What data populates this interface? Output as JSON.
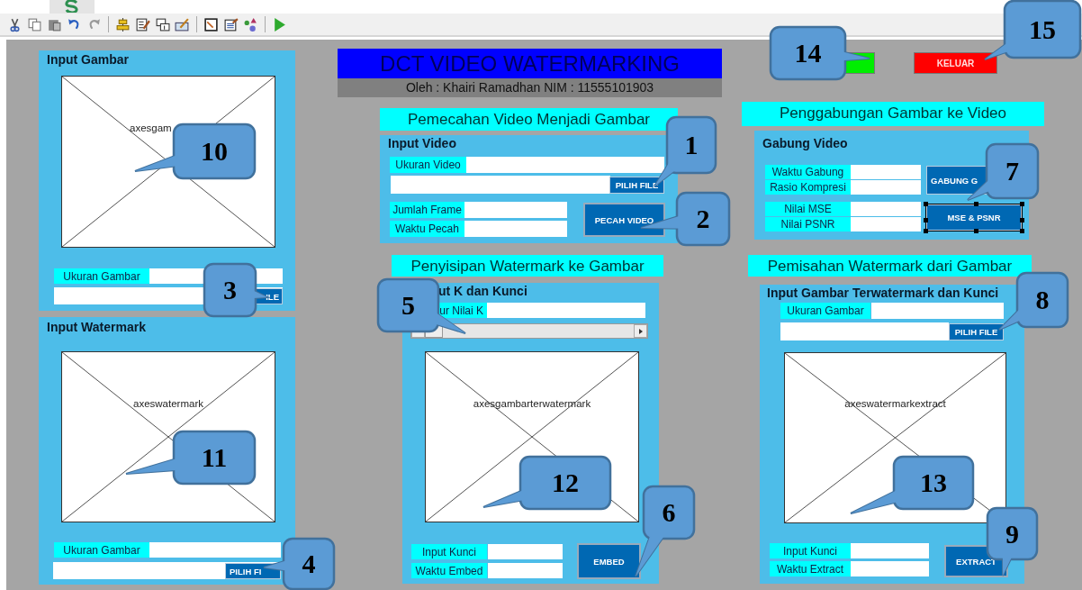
{
  "toolbar": {
    "groups": [
      [
        {
          "kind": "cut"
        },
        {
          "kind": "copy"
        },
        {
          "kind": "paste"
        },
        {
          "kind": "undo"
        },
        {
          "kind": "redo"
        }
      ],
      [
        {
          "kind": "align"
        },
        {
          "kind": "docpen"
        },
        {
          "kind": "tab"
        },
        {
          "kind": "pencilboard"
        }
      ],
      [
        {
          "kind": "notepad"
        },
        {
          "kind": "doclines"
        },
        {
          "kind": "shapes"
        }
      ],
      [
        {
          "kind": "run"
        }
      ]
    ]
  },
  "title": {
    "text": "DCT VIDEO WATERMARKING",
    "subtitle": "Oleh : Khairi Ramadhan NIM : 11555101903"
  },
  "input_gambar": {
    "title": "Input Gambar",
    "axes_label": "axesgam",
    "size_label": "Ukuran Gambar",
    "button": "ILE"
  },
  "input_watermark": {
    "title": "Input Watermark",
    "axes_label": "axeswatermark",
    "size_label": "Ukuran Gambar",
    "button": "PILIH FI"
  },
  "pemecahan": {
    "heading": "Pemecahan Video Menjadi Gambar",
    "title": "Input Video",
    "size_label": "Ukuran Video",
    "file_button": "PILIH FILE",
    "fields": [
      {
        "label": "Jumlah Frame"
      },
      {
        "label": "Waktu Pecah"
      }
    ],
    "button": "PECAH VIDEO"
  },
  "exit_button": "KELUAR",
  "penggabungan": {
    "heading": "Penggabungan Gambar ke Video",
    "title": "Gabung Video",
    "fields": [
      {
        "label": "Waktu Gabung"
      },
      {
        "label": "Rasio Kompresi"
      },
      {
        "label": "Nilai MSE"
      },
      {
        "label": "Nilai PSNR"
      }
    ],
    "buttons": [
      {
        "label": "GABUNG G",
        "selected": false
      },
      {
        "label": "MSE & PSNR",
        "selected": true
      }
    ]
  },
  "penyisipan": {
    "heading": "Penyisipan Watermark ke Gambar",
    "title": "ut K dan Kunci",
    "k_label": "ur Nilai K",
    "slider": {
      "level": 0
    },
    "axes_label": "axesgambarterwatermark",
    "fields": [
      {
        "label": "Input Kunci"
      },
      {
        "label": "Waktu Embed"
      }
    ],
    "button": "EMBED"
  },
  "pemisahan": {
    "heading": "Pemisahan Watermark dari Gambar",
    "title": "Input Gambar Terwatermark dan Kunci",
    "size_label": "Ukuran Gambar",
    "file_button": "PILIH FILE",
    "axes_label": "axeswatermarkextract",
    "fields": [
      {
        "label": "Input Kunci"
      },
      {
        "label": "Waktu Extract"
      }
    ],
    "button": "EXTRACT"
  },
  "callouts": [
    {
      "label": "1"
    },
    {
      "label": "2"
    },
    {
      "label": "3"
    },
    {
      "label": "4"
    },
    {
      "label": "5"
    },
    {
      "label": "6"
    },
    {
      "label": "7"
    },
    {
      "label": "8"
    },
    {
      "label": "9"
    },
    {
      "label": "10"
    },
    {
      "label": "11"
    },
    {
      "label": "12"
    },
    {
      "label": "13"
    },
    {
      "label": "14"
    },
    {
      "label": "15"
    }
  ]
}
